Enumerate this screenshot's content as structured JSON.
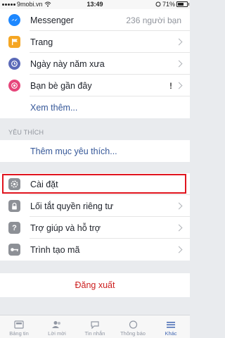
{
  "status": {
    "carrier": "9mobi.vn",
    "time": "13:49",
    "battery": "71%",
    "battery_level": 0.71
  },
  "top_items": [
    {
      "label": "Messenger",
      "detail": "236 người bạn",
      "icon": "messenger-icon",
      "color": "#1e88ff"
    },
    {
      "label": "Trang",
      "icon": "flag-icon",
      "color": "#f5a623"
    },
    {
      "label": "Ngày này năm xưa",
      "icon": "history-clock-icon",
      "color": "#5b6ab8"
    },
    {
      "label": "Bạn bè gần đây",
      "detail": "!",
      "icon": "nearby-friends-icon",
      "color": "#e6457a"
    }
  ],
  "see_more": "Xem thêm...",
  "favorites": {
    "header": "YÊU THÍCH",
    "add": "Thêm mục yêu thích..."
  },
  "settings_items": [
    {
      "label": "Cài đặt",
      "icon": "gear-icon"
    },
    {
      "label": "Lối tắt quyền riêng tư",
      "icon": "lock-icon"
    },
    {
      "label": "Trợ giúp và hỗ trợ",
      "icon": "help-icon"
    },
    {
      "label": "Trình tạo mã",
      "icon": "key-icon"
    }
  ],
  "logout": "Đăng xuất",
  "tabs": [
    {
      "label": "Bảng tin",
      "icon": "news-feed-icon"
    },
    {
      "label": "Lời mời",
      "icon": "friend-requests-icon"
    },
    {
      "label": "Tin nhắn",
      "icon": "messages-icon"
    },
    {
      "label": "Thông báo",
      "icon": "notifications-icon"
    },
    {
      "label": "Khác",
      "icon": "menu-icon",
      "active": true
    }
  ],
  "colors": {
    "accent": "#4267b2",
    "link": "#365899",
    "highlight": "#e0141e",
    "logout": "#cc1f1f"
  }
}
